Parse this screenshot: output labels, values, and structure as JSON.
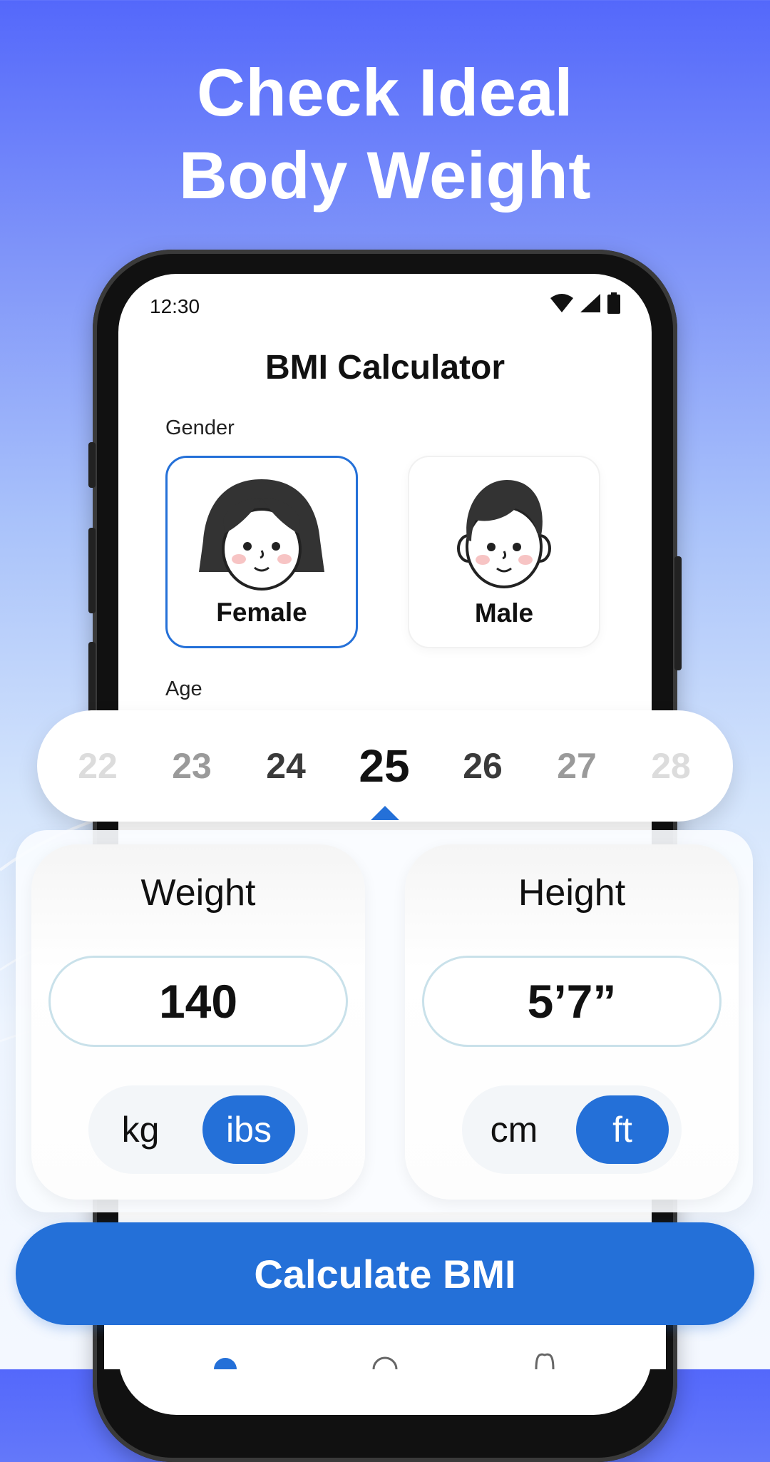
{
  "promo": {
    "line1": "Check Ideal",
    "line2": "Body Weight"
  },
  "status_bar": {
    "time": "12:30",
    "icons": [
      "wifi-icon",
      "signal-icon",
      "battery-icon"
    ]
  },
  "app": {
    "title": "BMI Calculator"
  },
  "gender": {
    "label": "Gender",
    "options": [
      {
        "label": "Female",
        "selected": true
      },
      {
        "label": "Male",
        "selected": false
      }
    ]
  },
  "age": {
    "label": "Age",
    "values": [
      "22",
      "23",
      "24",
      "25",
      "26",
      "27",
      "28"
    ],
    "selected": "25"
  },
  "weight": {
    "title": "Weight",
    "value": "140",
    "units": [
      "kg",
      "ibs"
    ],
    "active_unit": "ibs"
  },
  "height": {
    "title": "Height",
    "value": "5’7”",
    "units": [
      "cm",
      "ft"
    ],
    "active_unit": "ft"
  },
  "actions": {
    "calculate_label": "Calculate BMI"
  },
  "colors": {
    "accent": "#2470d8",
    "gradient_top": "#5468fb",
    "gradient_bottom": "#f4f8ff"
  }
}
